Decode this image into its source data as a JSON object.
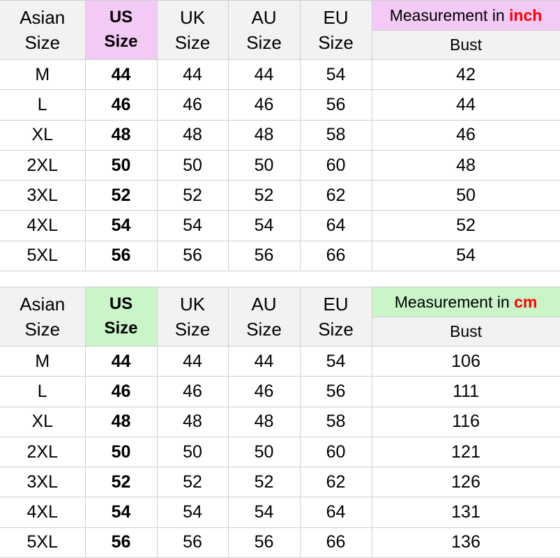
{
  "tables": [
    {
      "headers": {
        "asian": [
          "Asian",
          "Size"
        ],
        "us": [
          "US",
          "Size"
        ],
        "uk": [
          "UK",
          "Size"
        ],
        "au": [
          "AU",
          "Size"
        ],
        "eu": [
          "EU",
          "Size"
        ],
        "measurement_prefix": "Measurement in ",
        "measurement_unit": "inch",
        "bust": "Bust"
      },
      "rows": [
        [
          "M",
          "44",
          "44",
          "44",
          "54",
          "42"
        ],
        [
          "L",
          "46",
          "46",
          "46",
          "56",
          "44"
        ],
        [
          "XL",
          "48",
          "48",
          "48",
          "58",
          "46"
        ],
        [
          "2XL",
          "50",
          "50",
          "50",
          "60",
          "48"
        ],
        [
          "3XL",
          "52",
          "52",
          "52",
          "62",
          "50"
        ],
        [
          "4XL",
          "54",
          "54",
          "54",
          "64",
          "52"
        ],
        [
          "5XL",
          "56",
          "56",
          "56",
          "66",
          "54"
        ]
      ],
      "highlight_color": "#f3c9f5"
    },
    {
      "headers": {
        "asian": [
          "Asian",
          "Size"
        ],
        "us": [
          "US",
          "Size"
        ],
        "uk": [
          "UK",
          "Size"
        ],
        "au": [
          "AU",
          "Size"
        ],
        "eu": [
          "EU",
          "Size"
        ],
        "measurement_prefix": "Measurement in ",
        "measurement_unit": "cm",
        "bust": "Bust"
      },
      "rows": [
        [
          "M",
          "44",
          "44",
          "44",
          "54",
          "106"
        ],
        [
          "L",
          "46",
          "46",
          "46",
          "56",
          "111"
        ],
        [
          "XL",
          "48",
          "48",
          "48",
          "58",
          "116"
        ],
        [
          "2XL",
          "50",
          "50",
          "50",
          "60",
          "121"
        ],
        [
          "3XL",
          "52",
          "52",
          "52",
          "62",
          "126"
        ],
        [
          "4XL",
          "54",
          "54",
          "54",
          "64",
          "131"
        ],
        [
          "5XL",
          "56",
          "56",
          "56",
          "66",
          "136"
        ]
      ],
      "highlight_color": "#c9f5c9"
    }
  ],
  "unit_color": "#ff0000"
}
